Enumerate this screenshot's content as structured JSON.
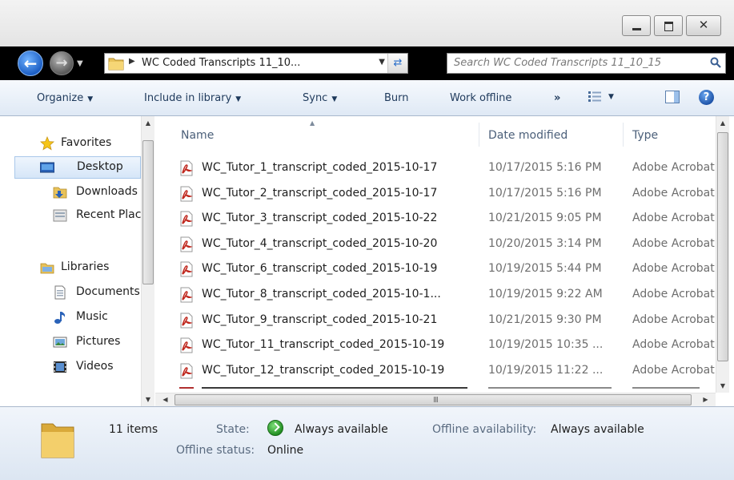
{
  "window": {
    "caption_close_glyph": "✕"
  },
  "navigation": {
    "address_path": "WC Coded Transcripts 11_10...",
    "search_placeholder": "Search WC Coded Transcripts 11_10_15"
  },
  "toolbar": {
    "organize": "Organize",
    "include_in_library": "Include in library",
    "sync": "Sync",
    "burn": "Burn",
    "work_offline": "Work offline",
    "more": "»"
  },
  "nav_pane": {
    "favorites_label": "Favorites",
    "favorites": [
      "Desktop",
      "Downloads",
      "Recent Places"
    ],
    "libraries_label": "Libraries",
    "libraries": [
      "Documents",
      "Music",
      "Pictures",
      "Videos"
    ]
  },
  "file_list": {
    "columns": {
      "name": "Name",
      "date_modified": "Date modified",
      "type": "Type"
    },
    "files": [
      {
        "name": "WC_Tutor_1_transcript_coded_2015-10-17",
        "date": "10/17/2015 5:16 PM",
        "type": "Adobe Acrobat"
      },
      {
        "name": "WC_Tutor_2_transcript_coded_2015-10-17",
        "date": "10/17/2015 5:16 PM",
        "type": "Adobe Acrobat"
      },
      {
        "name": "WC_Tutor_3_transcript_coded_2015-10-22",
        "date": "10/21/2015 9:05 PM",
        "type": "Adobe Acrobat"
      },
      {
        "name": "WC_Tutor_4_transcript_coded_2015-10-20",
        "date": "10/20/2015 3:14 PM",
        "type": "Adobe Acrobat"
      },
      {
        "name": "WC_Tutor_6_transcript_coded_2015-10-19",
        "date": "10/19/2015 5:44 PM",
        "type": "Adobe Acrobat"
      },
      {
        "name": "WC_Tutor_8_transcript_coded_2015-10-1...",
        "date": "10/19/2015 9:22 AM",
        "type": "Adobe Acrobat"
      },
      {
        "name": "WC_Tutor_9_transcript_coded_2015-10-21",
        "date": "10/21/2015 9:30 PM",
        "type": "Adobe Acrobat"
      },
      {
        "name": "WC_Tutor_11_transcript_coded_2015-10-19",
        "date": "10/19/2015 10:35 ...",
        "type": "Adobe Acrobat"
      },
      {
        "name": "WC_Tutor_12_transcript_coded_2015-10-19",
        "date": "10/19/2015 11:22 ...",
        "type": "Adobe Acrobat"
      }
    ],
    "hscroll_grip": "III"
  },
  "details_pane": {
    "item_count": "11 items",
    "state_label": "State:",
    "state_value": "Always available",
    "offline_availability_label": "Offline availability:",
    "offline_availability_value": "Always available",
    "offline_status_label": "Offline status:",
    "offline_status_value": "Online"
  },
  "colors": {
    "accent": "#1e395b",
    "nav_bar": "#000000",
    "pdf_red": "#c0281e"
  }
}
